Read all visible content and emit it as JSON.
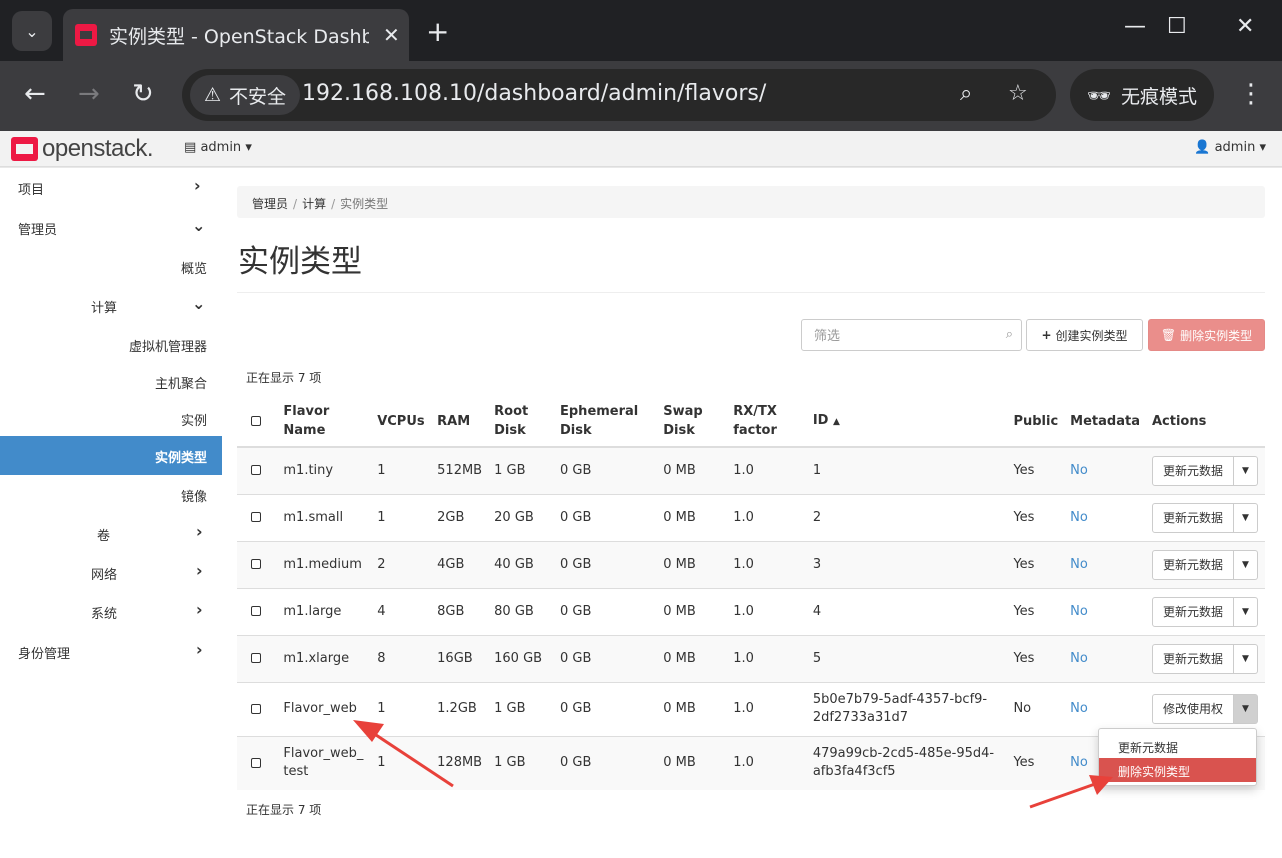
{
  "browser": {
    "tab_title": "实例类型 - OpenStack Dashboard",
    "security_label": "不安全",
    "url": "192.168.108.10/dashboard/admin/flavors/",
    "incognito_label": "无痕模式"
  },
  "header": {
    "logo_text": "openstack.",
    "project_label": "admin",
    "user_label": "admin"
  },
  "sidebar": {
    "project": "项目",
    "admin": "管理员",
    "overview": "概览",
    "compute": "计算",
    "hypervisors": "虚拟机管理器",
    "host_aggregates": "主机聚合",
    "instances": "实例",
    "flavors": "实例类型",
    "images": "镜像",
    "volumes": "卷",
    "network": "网络",
    "system": "系统",
    "identity": "身份管理"
  },
  "breadcrumb": {
    "item1": "管理员",
    "item2": "计算",
    "item3": "实例类型"
  },
  "page_title": "实例类型",
  "toolbar": {
    "filter_placeholder": "筛选",
    "create_label": "创建实例类型",
    "delete_label": "删除实例类型"
  },
  "count_text": "正在显示 7 项",
  "table": {
    "headers": {
      "name": "Flavor Name",
      "vcpus": "VCPUs",
      "ram": "RAM",
      "root_disk": "Root Disk",
      "ephemeral_disk": "Ephemeral Disk",
      "swap_disk": "Swap Disk",
      "rxtx": "RX/TX factor",
      "id": "ID",
      "public": "Public",
      "metadata": "Metadata",
      "actions": "Actions"
    },
    "rows": [
      {
        "name": "m1.tiny",
        "vcpus": "1",
        "ram": "512MB",
        "root": "1 GB",
        "eph": "0 GB",
        "swap": "0 MB",
        "rxtx": "1.0",
        "id": "1",
        "public": "Yes",
        "metadata": "No",
        "action": "更新元数据"
      },
      {
        "name": "m1.small",
        "vcpus": "1",
        "ram": "2GB",
        "root": "20 GB",
        "eph": "0 GB",
        "swap": "0 MB",
        "rxtx": "1.0",
        "id": "2",
        "public": "Yes",
        "metadata": "No",
        "action": "更新元数据"
      },
      {
        "name": "m1.medium",
        "vcpus": "2",
        "ram": "4GB",
        "root": "40 GB",
        "eph": "0 GB",
        "swap": "0 MB",
        "rxtx": "1.0",
        "id": "3",
        "public": "Yes",
        "metadata": "No",
        "action": "更新元数据"
      },
      {
        "name": "m1.large",
        "vcpus": "4",
        "ram": "8GB",
        "root": "80 GB",
        "eph": "0 GB",
        "swap": "0 MB",
        "rxtx": "1.0",
        "id": "4",
        "public": "Yes",
        "metadata": "No",
        "action": "更新元数据"
      },
      {
        "name": "m1.xlarge",
        "vcpus": "8",
        "ram": "16GB",
        "root": "160 GB",
        "eph": "0 GB",
        "swap": "0 MB",
        "rxtx": "1.0",
        "id": "5",
        "public": "Yes",
        "metadata": "No",
        "action": "更新元数据"
      },
      {
        "name": "Flavor_web",
        "vcpus": "1",
        "ram": "1.2GB",
        "root": "1 GB",
        "eph": "0 GB",
        "swap": "0 MB",
        "rxtx": "1.0",
        "id": "5b0e7b79-5adf-4357-bcf9-2df2733a31d7",
        "public": "No",
        "metadata": "No",
        "action": "修改使用权"
      },
      {
        "name": "Flavor_web_test",
        "vcpus": "1",
        "ram": "128MB",
        "root": "1 GB",
        "eph": "0 GB",
        "swap": "0 MB",
        "rxtx": "1.0",
        "id": "479a99cb-2cd5-485e-95d4-afb3fa4f3cf5",
        "public": "Yes",
        "metadata": "No",
        "action": ""
      }
    ]
  },
  "dropdown": {
    "item1": "更新元数据",
    "item2": "删除实例类型"
  },
  "colors": {
    "accent": "#428bca",
    "danger": "#d9534f",
    "annotation": "#e8413a"
  }
}
